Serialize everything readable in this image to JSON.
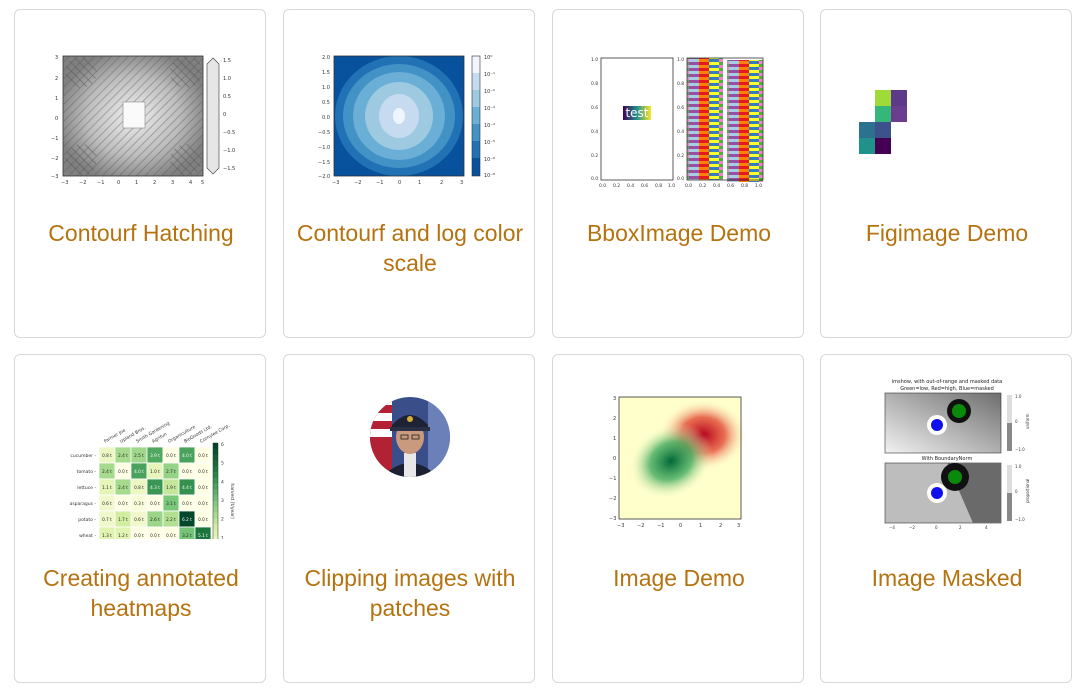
{
  "gallery": {
    "items": [
      {
        "title": "Contourf Hatching"
      },
      {
        "title": "Contourf and log color scale"
      },
      {
        "title": "BboxImage Demo",
        "thumb_text": "test"
      },
      {
        "title": "Figimage Demo"
      },
      {
        "title": "Creating annotated heatmaps",
        "heatmap": {
          "farmers": [
            "Farmer Joe",
            "Upland Bros.",
            "Smith Gardening",
            "Agrifun",
            "Organiculture",
            "BioGoods Ltd.",
            "Cornylee Corp."
          ],
          "vegetables": [
            "cucumber",
            "tomato",
            "lettuce",
            "asparagus",
            "potato",
            "wheat",
            "barley"
          ],
          "values": [
            [
              "0.8 t",
              "2.4 t",
              "2.5 t",
              "3.9 t",
              "0.0 t",
              "4.0 t",
              "0.0 t"
            ],
            [
              "2.4 t",
              "0.0 t",
              "4.0 t",
              "1.0 t",
              "2.7 t",
              "0.0 t",
              "0.0 t"
            ],
            [
              "1.1 t",
              "2.4 t",
              "0.8 t",
              "4.3 t",
              "1.9 t",
              "4.4 t",
              "0.0 t"
            ],
            [
              "0.6 t",
              "0.0 t",
              "0.3 t",
              "0.0 t",
              "3.1 t",
              "0.0 t",
              "0.0 t"
            ],
            [
              "0.7 t",
              "1.7 t",
              "0.6 t",
              "2.6 t",
              "2.2 t",
              "6.2 t",
              "0.0 t"
            ],
            [
              "1.3 t",
              "1.2 t",
              "0.0 t",
              "0.0 t",
              "0.0 t",
              "3.2 t",
              "5.1 t"
            ],
            [
              "0.1 t",
              "2.0 t",
              "0.0 t",
              "1.4 t",
              "0.0 t",
              "1.9 t",
              "6.3 t"
            ]
          ],
          "colorbar_label": "harvest [t/year]",
          "colorbar_ticks": [
            "6",
            "5",
            "4",
            "3",
            "2",
            "1",
            "0"
          ]
        }
      },
      {
        "title": "Clipping images with patches"
      },
      {
        "title": "Image Demo"
      },
      {
        "title": "Image Masked",
        "thumb_title": "imshow, with out-of-range and masked data",
        "thumb_subtitle": "Green=low, Red=high, Blue=masked",
        "thumb_subtitle2": "With BoundaryNorm",
        "cbar_label1": "uniform",
        "cbar_label2": "proportional"
      }
    ]
  },
  "colors": {
    "link": "#b6720f",
    "border": "#d8d8d8"
  }
}
